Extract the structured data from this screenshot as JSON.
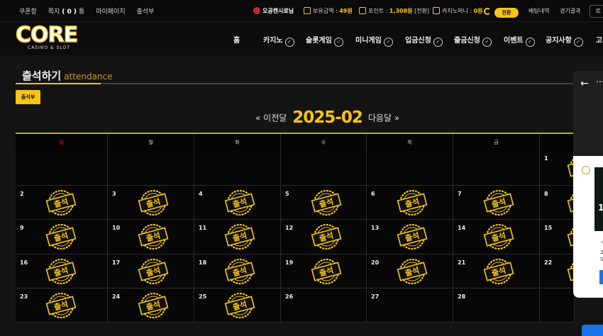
{
  "topbar": {
    "coupon": "쿠폰함",
    "note_prefix": "쪽지",
    "note_count": "( 0 )",
    "note_suffix": "통",
    "mypage": "마이페이지",
    "attendance": "출석부",
    "username": "오공캔시로님",
    "balance_label": "보유금액 :",
    "balance_value": "49원",
    "point_label": "포인트 :",
    "point_value": "1,308원",
    "point_action": "[전환]",
    "casino_money_label": "카지노머니 :",
    "casino_money_value": "0원",
    "convert_button": "전환",
    "bet_history": "베팅내역",
    "results": "경기결과",
    "cutoff": "로"
  },
  "logo": {
    "text": "CORE",
    "sub": "CASINO & SLOT"
  },
  "nav": {
    "items": [
      "홈",
      "카지노",
      "슬롯게임",
      "미니게임",
      "입금신청",
      "출금신청",
      "이벤트",
      "공지사항",
      "고"
    ]
  },
  "page": {
    "title": "출석하기",
    "subtitle": "attendance",
    "book_button": "출석부"
  },
  "calendar": {
    "prev": "« 이전달",
    "month": "2025-02",
    "next": "다음달 »",
    "weekdays": [
      "일",
      "월",
      "화",
      "수",
      "목",
      "금",
      ""
    ],
    "stamp_text": "출석",
    "weeks": [
      [
        {
          "d": "",
          "s": false
        },
        {
          "d": "",
          "s": false
        },
        {
          "d": "",
          "s": false
        },
        {
          "d": "",
          "s": false
        },
        {
          "d": "",
          "s": false
        },
        {
          "d": "",
          "s": false
        },
        {
          "d": "1",
          "s": true
        }
      ],
      [
        {
          "d": "2",
          "s": true
        },
        {
          "d": "3",
          "s": true
        },
        {
          "d": "4",
          "s": true
        },
        {
          "d": "5",
          "s": true
        },
        {
          "d": "6",
          "s": true
        },
        {
          "d": "7",
          "s": true
        },
        {
          "d": "8",
          "s": true
        }
      ],
      [
        {
          "d": "9",
          "s": true
        },
        {
          "d": "10",
          "s": true
        },
        {
          "d": "11",
          "s": true
        },
        {
          "d": "12",
          "s": true
        },
        {
          "d": "13",
          "s": true
        },
        {
          "d": "14",
          "s": true
        },
        {
          "d": "15",
          "s": true
        }
      ],
      [
        {
          "d": "16",
          "s": true
        },
        {
          "d": "17",
          "s": true
        },
        {
          "d": "18",
          "s": true
        },
        {
          "d": "19",
          "s": true
        },
        {
          "d": "20",
          "s": true
        },
        {
          "d": "21",
          "s": true
        },
        {
          "d": "22",
          "s": true
        }
      ],
      [
        {
          "d": "23",
          "s": true
        },
        {
          "d": "24",
          "s": true
        },
        {
          "d": "25",
          "s": true
        },
        {
          "d": "26",
          "s": false
        },
        {
          "d": "27",
          "s": false
        },
        {
          "d": "28",
          "s": false
        },
        {
          "d": "",
          "s": false
        }
      ]
    ]
  },
  "overlay": {
    "thumb_char": "1",
    "lines": [
      "ㅋ",
      "2",
      "S"
    ]
  },
  "colors": {
    "accent": "#f5c518",
    "sunday": "#e02020",
    "background": "#141414"
  }
}
